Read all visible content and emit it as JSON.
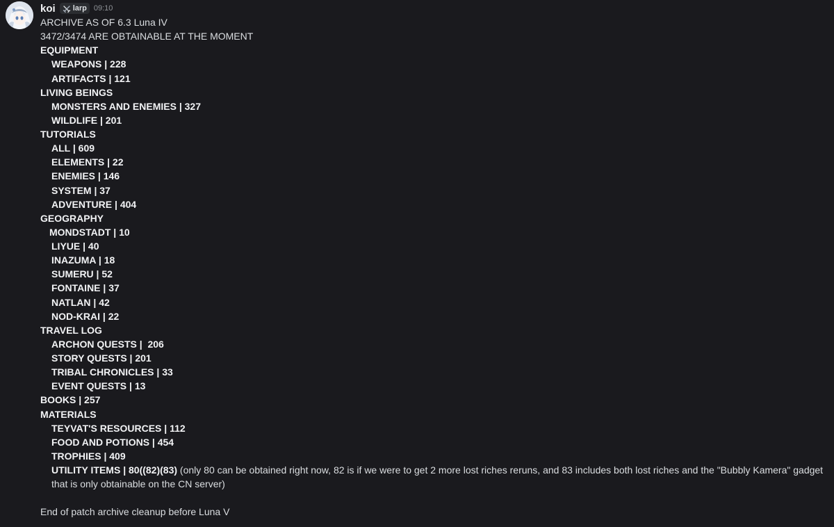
{
  "author": {
    "name": "koi",
    "tag": "larp",
    "tag_icon": "crossed-swords-icon",
    "time": "09:10"
  },
  "lines": {
    "l01": "ARCHIVE AS OF 6.3 Luna IV",
    "l02": "3472/3474 ARE OBTAINABLE AT THE MOMENT",
    "l03": "EQUIPMENT",
    "l04": "WEAPONS | 228",
    "l05": "ARTIFACTS | 121",
    "l06": "LIVING BEINGS",
    "l07": "MONSTERS AND ENEMIES | 327",
    "l08": "WILDLIFE | 201",
    "l09": "TUTORIALS",
    "l10": "ALL | 609",
    "l11": "ELEMENTS | 22",
    "l12": "ENEMIES | 146",
    "l13": "SYSTEM | 37",
    "l14": "ADVENTURE | 404",
    "l15": "GEOGRAPHY",
    "l16": "MONDSTADT | 10",
    "l17": "LIYUE | 40",
    "l18": "INAZUMA | 18",
    "l19": "SUMERU | 52",
    "l20": "FONTAINE | 37",
    "l21": "NATLAN | 42",
    "l22": "NOD-KRAI | 22",
    "l23": "TRAVEL LOG",
    "l24": "ARCHON QUESTS |  206",
    "l25": "STORY QUESTS | 201",
    "l26": "TRIBAL CHRONICLES | 33",
    "l27": "EVENT QUESTS | 13",
    "l28": "BOOKS | 257",
    "l29": "MATERIALS",
    "l30": "TEYVAT'S RESOURCES | 112",
    "l31": "FOOD AND POTIONS | 454",
    "l32": "TROPHIES | 409",
    "l33_bold": "UTILITY ITEMS | 80((82)(83)",
    "l33_rest": " (only 80 can be obtained right now, 82 is if we were to get 2 more lost riches reruns, and 83 includes both lost riches and the \"Bubbly Kamera\" gadget that is only obtainable on the CN server)",
    "l34": "End of patch archive cleanup before Luna V"
  }
}
